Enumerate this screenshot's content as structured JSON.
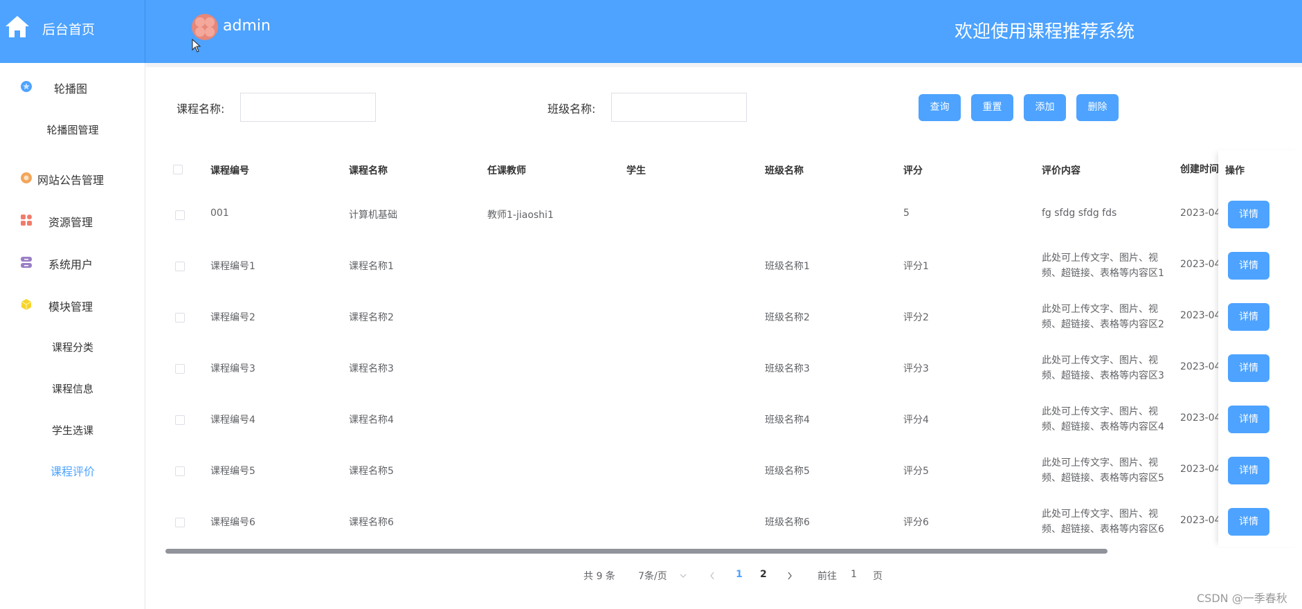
{
  "header": {
    "home_label": "后台首页",
    "user_name": "admin",
    "title": "欢迎使用课程推荐系统"
  },
  "sidebar": {
    "menus": [
      {
        "label": "轮播图",
        "icon": "star-badge-icon",
        "color": "#4da3ff"
      },
      {
        "label": "网站公告管理",
        "icon": "gear-badge-icon",
        "color": "#f2a65a"
      },
      {
        "label": "资源管理",
        "icon": "grid-icon",
        "color": "#f07c6c"
      },
      {
        "label": "系统用户",
        "icon": "database-icon",
        "color": "#9a7fc6"
      },
      {
        "label": "模块管理",
        "icon": "cube-icon",
        "color": "#f5d42b"
      }
    ],
    "subs": {
      "carousel": "轮播图管理",
      "category": "课程分类",
      "info": "课程信息",
      "select": "学生选课",
      "evaluate": "课程评价"
    }
  },
  "search": {
    "course_name_label": "课程名称:",
    "course_name_value": "",
    "class_name_label": "班级名称:",
    "class_name_value": ""
  },
  "buttons": {
    "query": "查询",
    "reset": "重置",
    "add": "添加",
    "delete": "删除"
  },
  "table": {
    "headers": [
      "课程编号",
      "课程名称",
      "任课教师",
      "学生",
      "班级名称",
      "评分",
      "评价内容",
      "创建时间"
    ],
    "op_header": "操作",
    "detail_label": "详情",
    "rows": [
      [
        "001",
        "计算机基础",
        "教师1-jiaoshi1",
        "",
        "",
        "5",
        "fg sfdg sfdg fds",
        "2023-04"
      ],
      [
        "课程编号1",
        "课程名称1",
        "",
        "",
        "班级名称1",
        "评分1",
        "此处可上传文字、图片、视频、超链接、表格等内容区1",
        "2023-04"
      ],
      [
        "课程编号2",
        "课程名称2",
        "",
        "",
        "班级名称2",
        "评分2",
        "此处可上传文字、图片、视频、超链接、表格等内容区2",
        "2023-04"
      ],
      [
        "课程编号3",
        "课程名称3",
        "",
        "",
        "班级名称3",
        "评分3",
        "此处可上传文字、图片、视频、超链接、表格等内容区3",
        "2023-04"
      ],
      [
        "课程编号4",
        "课程名称4",
        "",
        "",
        "班级名称4",
        "评分4",
        "此处可上传文字、图片、视频、超链接、表格等内容区4",
        "2023-04"
      ],
      [
        "课程编号5",
        "课程名称5",
        "",
        "",
        "班级名称5",
        "评分5",
        "此处可上传文字、图片、视频、超链接、表格等内容区5",
        "2023-04"
      ],
      [
        "课程编号6",
        "课程名称6",
        "",
        "",
        "班级名称6",
        "评分6",
        "此处可上传文字、图片、视频、超链接、表格等内容区6",
        "2023-04"
      ]
    ]
  },
  "pagination": {
    "total": "共 9 条",
    "page_size": "7条/页",
    "pages": [
      "1",
      "2"
    ],
    "current": "1",
    "goto_prefix": "前往",
    "goto_value": "1",
    "goto_suffix": "页"
  },
  "watermark": "CSDN @一季春秋",
  "colors": {
    "primary": "#4da3ff",
    "header_bg": "#4da3ff"
  }
}
